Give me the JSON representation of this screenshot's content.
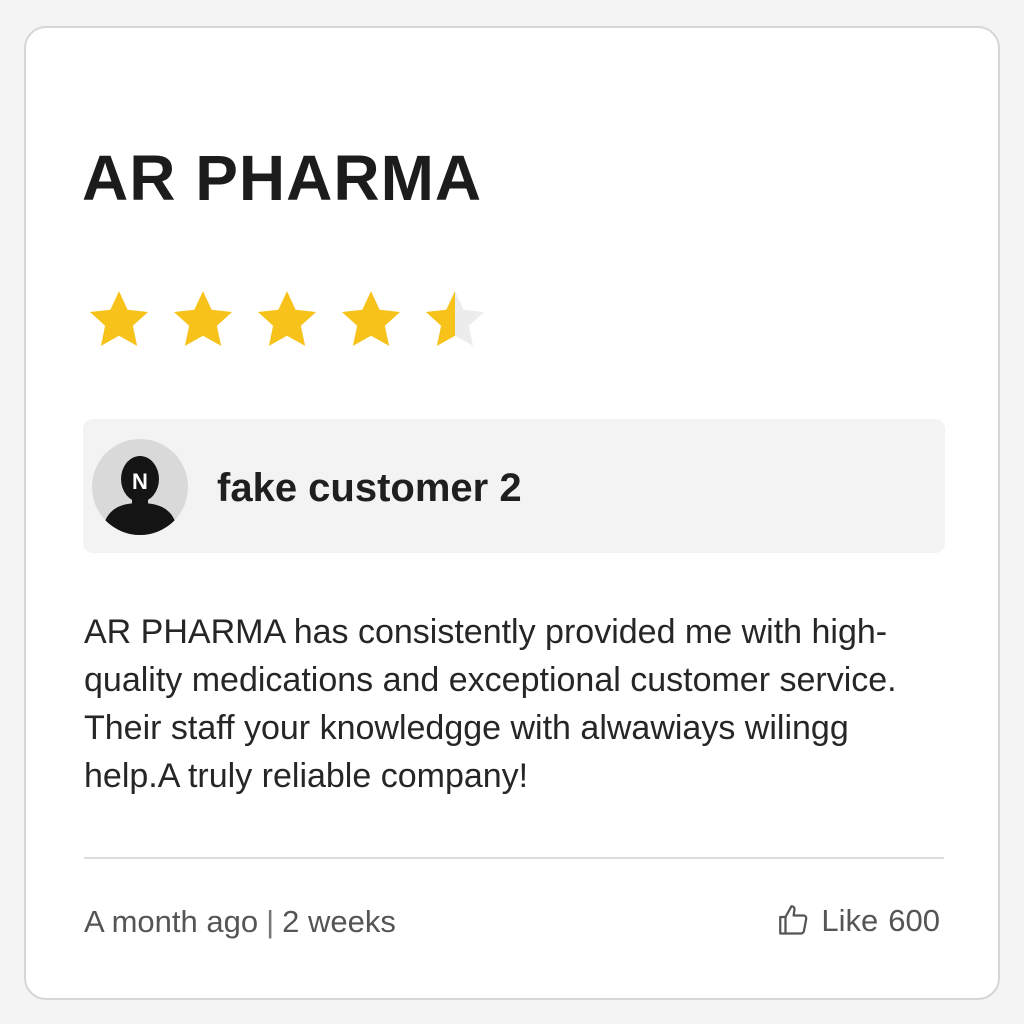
{
  "business": {
    "name": "AR PHARMA"
  },
  "rating": {
    "value": 4.5,
    "max": 5,
    "color": "#f7c21a"
  },
  "reviewer": {
    "avatar_letter": "N",
    "name": "fake customer 2"
  },
  "review": {
    "text": "AR PHARMA has consistently provided me with high-quality medications and exceptional customer service. Their staff your knowledgge with alwawiays wilingg help.A truly reliable company!"
  },
  "meta": {
    "posted": "A month ago",
    "separator": "|",
    "updated": "2 weeks"
  },
  "like": {
    "label": "Like",
    "count": "600",
    "icon": "thumbs-up-icon"
  }
}
